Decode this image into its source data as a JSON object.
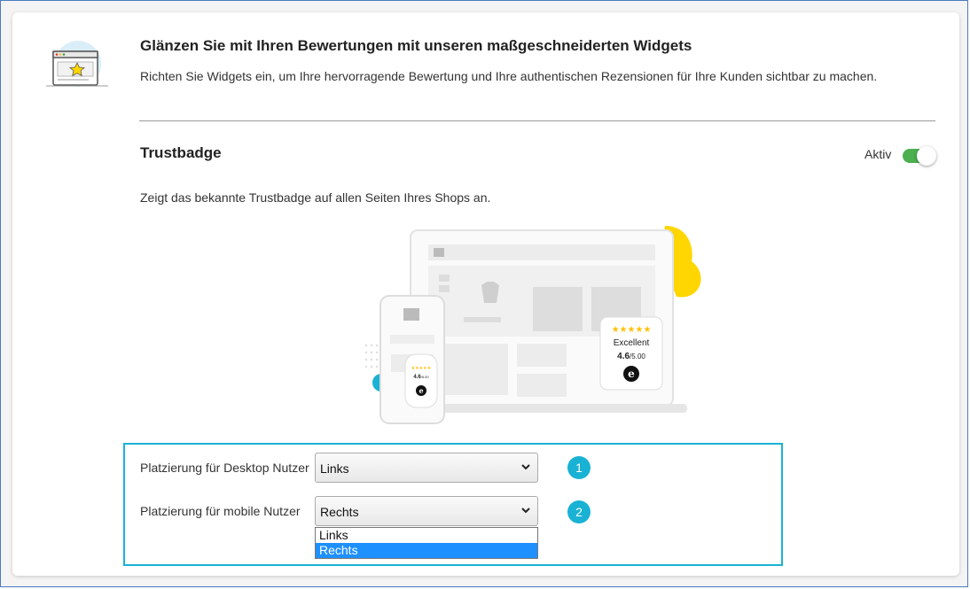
{
  "header": {
    "title": "Glänzen Sie mit Ihren Bewertungen mit unseren maßgeschneiderten Widgets",
    "subtitle": "Richten Sie Widgets ein, um Ihre hervorragende Bewertung und Ihre authentischen Rezensionen für Ihre Kunden sichtbar zu machen."
  },
  "trustbadge": {
    "title": "Trustbadge",
    "toggle_label": "Aktiv",
    "toggle_on": true,
    "description": "Zeigt das bekannte Trustbadge auf allen Seiten Ihres Shops an."
  },
  "illustration": {
    "badge_label": "Excellent",
    "score": "4.6",
    "score_max": "/5.00",
    "stars": "★★★★★",
    "logo_letter": "e",
    "accent": "#ffd600"
  },
  "placement": {
    "desktop_label": "Platzierung für Desktop Nutzer",
    "desktop_value": "Links",
    "desktop_badge": "1",
    "mobile_label": "Platzierung für mobile Nutzer",
    "mobile_value": "Rechts",
    "mobile_badge": "2",
    "options": [
      "Links",
      "Rechts"
    ]
  },
  "colors": {
    "highlight": "#1ab2d4",
    "toggle": "#4caf50",
    "selected_option": "#1e90ff"
  }
}
